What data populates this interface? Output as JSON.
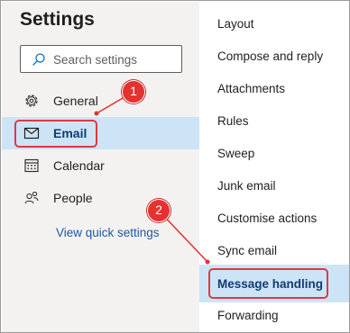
{
  "settings": {
    "title": "Settings",
    "search_placeholder": "Search settings"
  },
  "nav": {
    "items": [
      {
        "label": "General",
        "icon": "gear-icon"
      },
      {
        "label": "Email",
        "icon": "mail-icon",
        "selected": true
      },
      {
        "label": "Calendar",
        "icon": "calendar-icon"
      },
      {
        "label": "People",
        "icon": "people-icon"
      }
    ],
    "quick_settings_link": "View quick settings"
  },
  "submenu": {
    "items": [
      {
        "label": "Layout"
      },
      {
        "label": "Compose and reply"
      },
      {
        "label": "Attachments"
      },
      {
        "label": "Rules"
      },
      {
        "label": "Sweep"
      },
      {
        "label": "Junk email"
      },
      {
        "label": "Customise actions"
      },
      {
        "label": "Sync email"
      },
      {
        "label": "Message handling",
        "selected": true
      },
      {
        "label": "Forwarding"
      }
    ]
  },
  "annotations": {
    "callout_1": "1",
    "callout_2": "2",
    "color": "#e5312f"
  },
  "colors": {
    "selected_bg": "#cde4f7",
    "selected_text": "#0f3c75",
    "link": "#1b5aa6",
    "left_pane_bg": "#f3f2f1"
  }
}
